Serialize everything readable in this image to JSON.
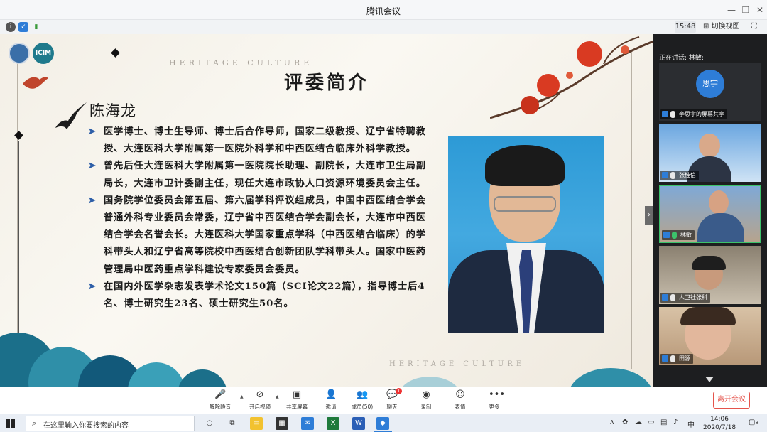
{
  "window": {
    "title": "腾讯会议"
  },
  "infobar": {
    "time": "15:48",
    "switch_view_label": "切换视图"
  },
  "slide": {
    "heritage_top": "HERITAGE CULTURE",
    "heritage_bottom": "HERITAGE CULTURE",
    "heading": "评委简介",
    "name": "陈海龙",
    "logo_text": "ICIM",
    "bullets": [
      "医学博士、博士生导师、博士后合作导师，国家二级教授、辽宁省特聘教授、大连医科大学附属第一医院外科学和中西医结合临床外科学教授。",
      "曾先后任大连医科大学附属第一医院院长助理、副院长，大连市卫生局副局长，大连市卫计委副主任，现任大连市政协人口资源环境委员会主任。",
      "国务院学位委员会第五届、第六届学科评议组成员，中国中西医结合学会普通外科专业委员会常委，辽宁省中西医结合学会副会长，大连市中西医结合学会名誉会长。大连医科大学国家重点学科（中西医结合临床）的学科带头人和辽宁省高等院校中西医结合创新团队学科带头人。国家中医药管理局中医药重点学科建设专家委员会委员。",
      "在国内外医学杂志发表学术论文150篇（SCI论文22篇），指导博士后4名、博士研究生23名、硕士研究生50名。"
    ]
  },
  "panel": {
    "speaker_label": "正在讲话: 林敏;",
    "tiles": [
      {
        "label": "李思宇的屏幕共享",
        "avatar": "思宇"
      },
      {
        "label": "张桂信"
      },
      {
        "label": "林敏"
      },
      {
        "label": "人卫社张科"
      },
      {
        "label": "田源"
      }
    ]
  },
  "toolbar": {
    "items": [
      {
        "label": "解除静音",
        "icon": "mic-muted-icon"
      },
      {
        "label": "开启视频",
        "icon": "camera-off-icon"
      },
      {
        "label": "共享屏幕",
        "icon": "screen-share-icon"
      },
      {
        "label": "邀请",
        "icon": "invite-icon"
      },
      {
        "label": "成员(50)",
        "icon": "members-icon"
      },
      {
        "label": "聊天",
        "icon": "chat-icon"
      },
      {
        "label": "录制",
        "icon": "record-icon"
      },
      {
        "label": "表情",
        "icon": "emoji-icon"
      },
      {
        "label": "更多",
        "icon": "more-icon"
      }
    ],
    "chat_badge": "1",
    "leave_label": "离开会议"
  },
  "taskbar": {
    "search_placeholder": "在这里输入你要搜索的内容",
    "ime": "中",
    "time": "14:06",
    "date": "2020/7/18",
    "notifications": "8"
  },
  "colors": {
    "accent": "#2e7dd7",
    "leave": "#e5534b",
    "bullet_arrow": "#2e5fa8",
    "photo_bg": "#2d9ad6"
  }
}
